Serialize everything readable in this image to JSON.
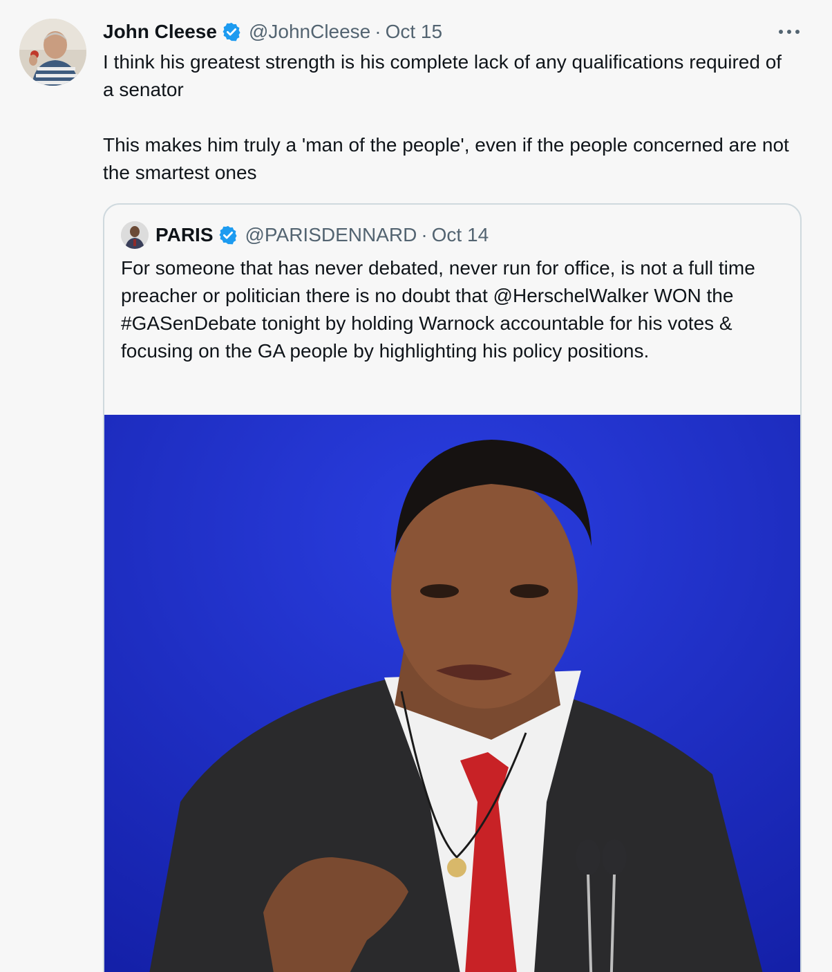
{
  "tweet": {
    "author_name": "John Cleese",
    "handle": "@JohnCleese",
    "separator": "·",
    "date": "Oct 15",
    "paragraphs": [
      "I think his greatest strength is his complete lack of any qualifications required of a senator",
      "This makes him truly a 'man of the people', even if the people concerned are not the smartest ones"
    ],
    "icons": {
      "verified": "verified-badge-icon",
      "more": "more-options-icon"
    }
  },
  "quoted_tweet": {
    "author_name": "PARIS",
    "handle": "@PARISDENNARD",
    "separator": "·",
    "date": "Oct 14",
    "text": "For someone that has never debated, never run for office, is not a full time preacher or politician there is no doubt that @HerschelWalker WON the #GASenDebate tonight by holding Warnock accountable for his votes & focusing on the GA people by highlighting his policy positions."
  },
  "colors": {
    "verified_blue": "#1d9bf0",
    "secondary_text": "#536471",
    "media_background": "#1d2bc4"
  }
}
